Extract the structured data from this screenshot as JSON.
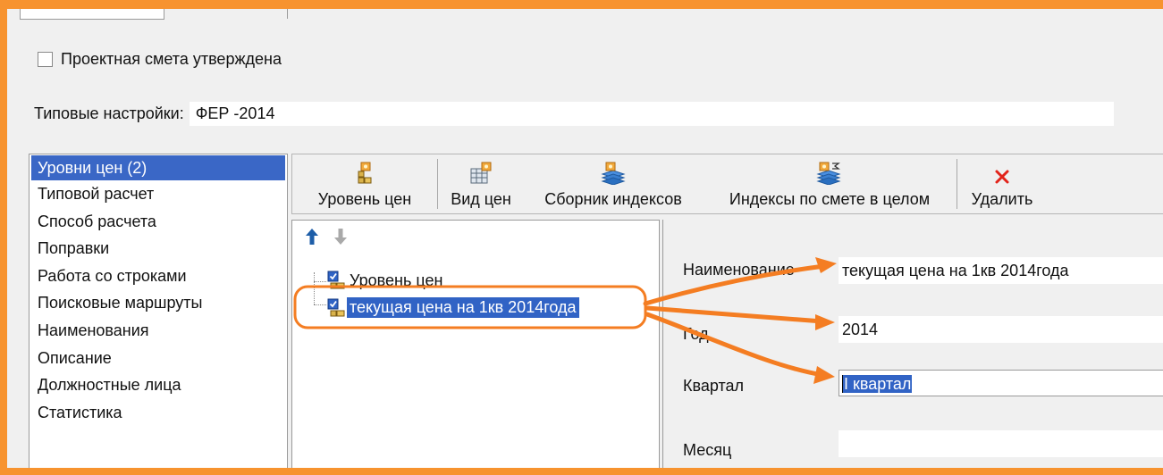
{
  "approved_checkbox": {
    "label": "Проектная смета утверждена",
    "checked": false
  },
  "preset": {
    "label": "Типовые настройки:",
    "value": "ФЕР -2014"
  },
  "nav": {
    "items": [
      {
        "label": "Уровни цен (2)",
        "active": true
      },
      {
        "label": "Типовой расчет"
      },
      {
        "label": "Способ расчета"
      },
      {
        "label": "Поправки"
      },
      {
        "label": "Работа со строками"
      },
      {
        "label": "Поисковые маршруты"
      },
      {
        "label": "Наименования"
      },
      {
        "label": "Описание"
      },
      {
        "label": "Должностные лица"
      },
      {
        "label": "Статистика"
      }
    ]
  },
  "toolbar": {
    "price_level_label": "Уровень цен",
    "price_type_label": "Вид цен",
    "index_collection_label": "Сборник индексов",
    "estimate_indexes_label": "Индексы по смете в целом",
    "delete_label": "Удалить"
  },
  "tree": {
    "root_label": "Уровень цен",
    "child_label": "текущая цена на 1кв 2014года"
  },
  "details": {
    "name_label": "Наименование",
    "name_value": "текущая цена на 1кв 2014года",
    "year_label": "Год",
    "year_value": "2014",
    "quarter_label": "Квартал",
    "quarter_value": "I квартал",
    "month_label": "Месяц",
    "month_value": ""
  },
  "colors": {
    "frame_orange": "#f7932f",
    "selection_blue": "#3163c5",
    "delete_red": "#e2231a"
  },
  "icons": [
    "price-level-icon",
    "price-type-icon",
    "index-collection-icon",
    "estimate-indexes-icon",
    "delete-x-icon",
    "move-up-arrow-icon",
    "move-down-arrow-icon",
    "tree-node-icon"
  ]
}
